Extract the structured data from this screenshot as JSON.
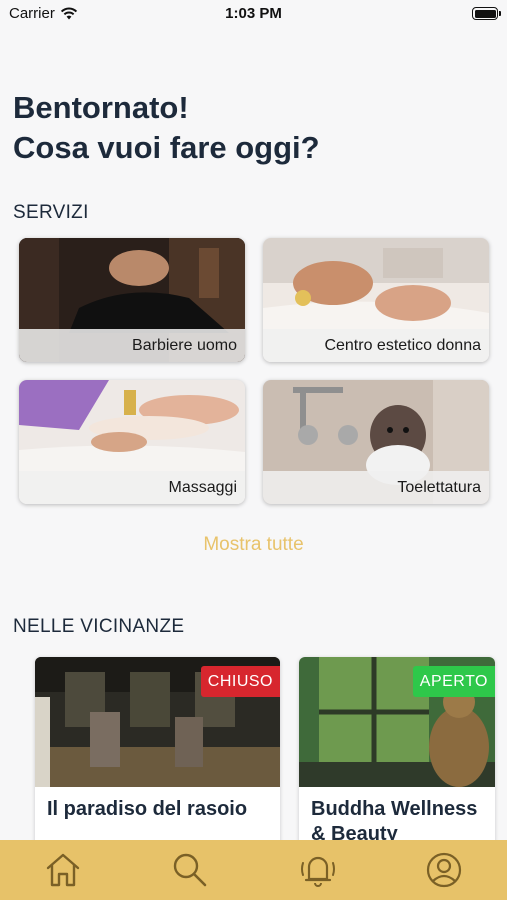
{
  "status_bar": {
    "carrier": "Carrier",
    "time": "1:03 PM"
  },
  "header": {
    "line1": "Bentornato!",
    "line2": "Cosa vuoi fare oggi?"
  },
  "services": {
    "title": "SERVIZI",
    "items": [
      {
        "label": "Barbiere uomo"
      },
      {
        "label": "Centro estetico donna"
      },
      {
        "label": "Massaggi"
      },
      {
        "label": "Toelettatura"
      }
    ],
    "show_all_label": "Mostra tutte"
  },
  "nearby": {
    "title": "NELLE VICINANZE",
    "places": [
      {
        "name": "Il paradiso del rasoio",
        "status": "CHIUSO",
        "status_color": "#d7262e"
      },
      {
        "name": "Buddha Wellness & Beauty",
        "status": "APERTO",
        "status_color": "#2ec84a"
      }
    ]
  },
  "tab_bar": {
    "tabs": [
      {
        "icon": "home-icon"
      },
      {
        "icon": "search-icon"
      },
      {
        "icon": "bell-icon"
      },
      {
        "icon": "profile-icon"
      }
    ],
    "accent": "#e7c269",
    "icon_color": "#7a6026"
  }
}
